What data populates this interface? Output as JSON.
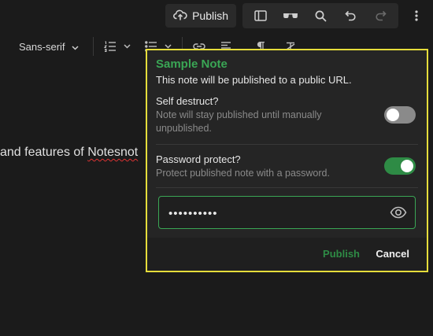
{
  "colors": {
    "background": "#1b1b1b",
    "accent": "#3aa655",
    "highlight_border": "#e6dd3b",
    "popup_bg": "#252525"
  },
  "top_toolbar": {
    "publish_label": "Publish",
    "publish_icon": "cloud-upload-icon",
    "icons": [
      "sidebar-toggle-icon",
      "glasses-icon",
      "search-icon",
      "undo-icon",
      "redo-icon"
    ],
    "menu_icon": "more-vertical-icon"
  },
  "format_toolbar": {
    "font_family": "Sans-serif",
    "icons": [
      "numbered-list-icon",
      "bullet-list-icon",
      "link-icon",
      "align-icon",
      "paragraph-icon",
      "clear-formatting-icon"
    ]
  },
  "editor": {
    "text_before": "and features of ",
    "text_misspelled": "Notesnot"
  },
  "publish_dialog": {
    "title": "Sample Note",
    "subtitle": "This note will be published to a public URL.",
    "self_destruct": {
      "label": "Self destruct?",
      "description": "Note will stay published until manually unpublished.",
      "enabled": false
    },
    "password_protect": {
      "label": "Password protect?",
      "description": "Protect published note with a password.",
      "enabled": true
    },
    "password_field": {
      "value": "••••••••••",
      "icon": "eye-icon"
    },
    "publish_label": "Publish",
    "cancel_label": "Cancel"
  }
}
